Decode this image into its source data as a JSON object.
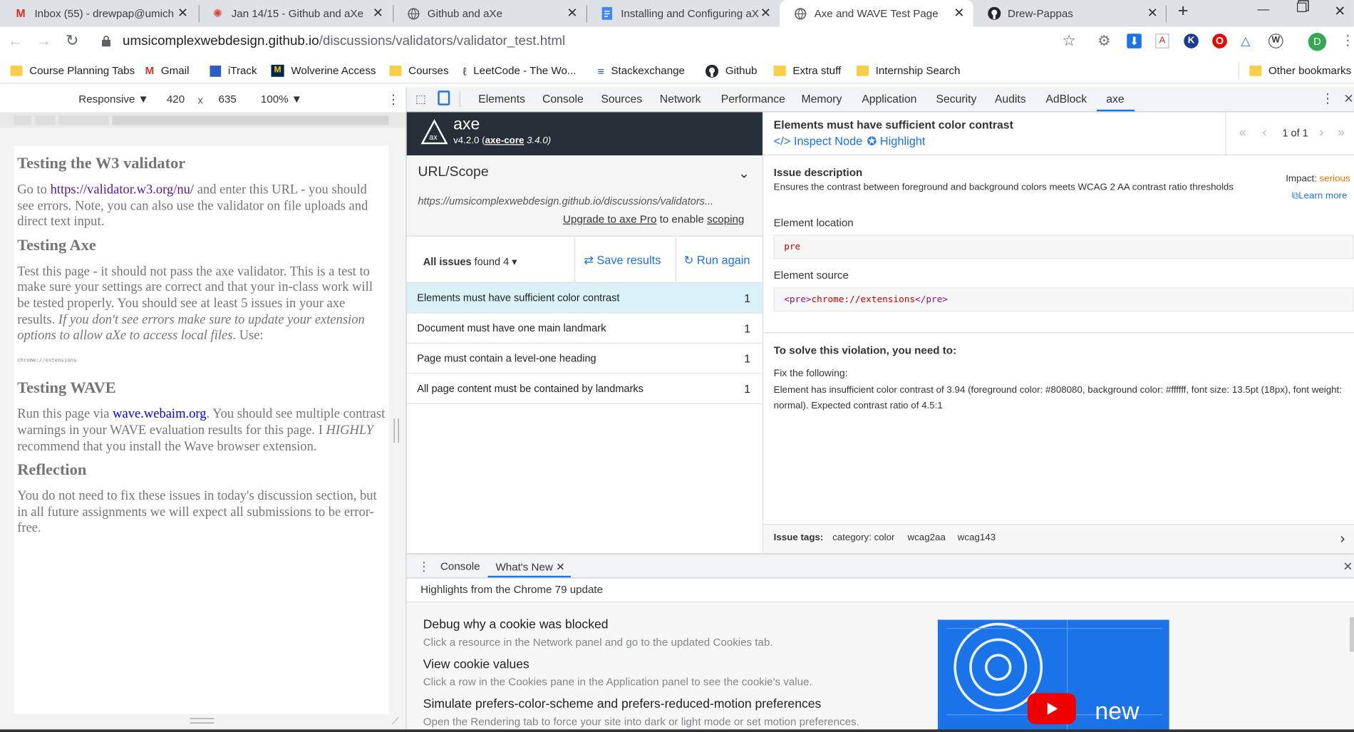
{
  "tabs": [
    {
      "label": "Inbox (55) - drewpap@umich",
      "icon": "gmail-icon"
    },
    {
      "label": "Jan 14/15 - Github and aXe",
      "icon": "canvas-icon"
    },
    {
      "label": "Github and aXe",
      "icon": "globe-icon"
    },
    {
      "label": "Installing and Configuring aX",
      "icon": "docs-icon"
    },
    {
      "label": "Axe and WAVE Test Page",
      "icon": "globe-icon"
    },
    {
      "label": "Drew-Pappas",
      "icon": "github-icon"
    }
  ],
  "address": {
    "host": "umsicomplexwebdesign.github.io",
    "path": "/discussions/validators/validator_test.html"
  },
  "profile_initial": "D",
  "bookmarks": [
    "Course Planning Tabs",
    "Gmail",
    "iTrack",
    "Wolverine Access",
    "Courses",
    "LeetCode - The Wo...",
    "Stackexchange",
    "Github",
    "Extra stuff",
    "Internship Search"
  ],
  "other_bookmarks": "Other bookmarks",
  "device_toolbar": {
    "mode": "Responsive ▼",
    "width": "420",
    "times": "x",
    "height": "635",
    "zoom": "100% ▼"
  },
  "devtools_tabs": [
    "Elements",
    "Console",
    "Sources",
    "Network",
    "Performance",
    "Memory",
    "Application",
    "Security",
    "Audits",
    "AdBlock",
    "axe"
  ],
  "page": {
    "h1": "Testing the W3 validator",
    "p1_pre": "Go to ",
    "p1_link": "https://validator.w3.org/nu/",
    "p1_post": " and enter this URL - you should see errors. Note, you can also use the validator on file uploads and direct text input.",
    "h2": "Testing Axe",
    "p2": "Test this page - it should not pass the axe validator. This is a test to make sure your settings are correct and that your in-class work will be tested properly. You should see at least 5 issues in your axe results. ",
    "p2_em": "If you don't see errors make sure to update your extension options to allow aXe to access local files",
    "p2_post": ". Use:",
    "pre": "chrome://extensions",
    "h3": "Testing WAVE",
    "p3_pre": "Run this page via ",
    "p3_link": "wave.webaim.org",
    "p3_post": ". You should see multiple contrast warnings in your WAVE evaluation results for this page. I ",
    "p3_em": "HIGHLY",
    "p3_post2": " recommend that you install the Wave browser extension.",
    "h4": "Reflection",
    "p4": "You do not need to fix these issues in today's discussion section, but in all future assignments we will expect all submissions to be error-free."
  },
  "axe": {
    "name": "axe",
    "version": "v4.2.0 (",
    "core": "axe-core",
    "core_version": " 3.4.0)",
    "scope_label": "URL/Scope",
    "scope_url": "https://umsicomplexwebdesign.github.io/discussions/validators...",
    "upgrade_link": "Upgrade to axe Pro",
    "upgrade_mid": " to enable ",
    "upgrade_scoping": "scoping",
    "issues_label": "All issues",
    "found_label": " found 4 ▾",
    "save_label": "Save results",
    "run_label": "Run again",
    "issues": [
      {
        "title": "Elements must have sufficient color contrast",
        "count": "1"
      },
      {
        "title": "Document must have one main landmark",
        "count": "1"
      },
      {
        "title": "Page must contain a level-one heading",
        "count": "1"
      },
      {
        "title": "All page content must be contained by landmarks",
        "count": "1"
      }
    ],
    "detail": {
      "title": "Elements must have sufficient color contrast",
      "inspect": "Inspect Node",
      "highlight": "Highlight",
      "pager": "1 of 1",
      "desc_label": "Issue description",
      "desc": "Ensures the contrast between foreground and background colors meets WCAG 2 AA contrast ratio thresholds",
      "impact_label": "Impact: ",
      "impact": "serious",
      "learn_more": "Learn more",
      "location_label": "Element location",
      "location": "pre",
      "source_label": "Element source",
      "source_open": "<pre>",
      "source_text": "chrome://extensions",
      "source_close": "</pre>",
      "solve_title": "To solve this violation, you need to:",
      "fix_label": "Fix the following:",
      "fix_text": "Element has insufficient color contrast of 3.94 (foreground color: #808080, background color: #ffffff, font size: 13.5pt (18px), font weight: normal). Expected contrast ratio of 4.5:1",
      "tags_label": "Issue tags:",
      "tags": [
        "category: color",
        "wcag2aa",
        "wcag143"
      ]
    }
  },
  "drawer": {
    "tabs": [
      "Console",
      "What's New"
    ],
    "header": "Highlights from the Chrome 79 update",
    "items": [
      {
        "title": "Debug why a cookie was blocked",
        "sub": "Click a resource in the Network panel and go to the updated Cookies tab."
      },
      {
        "title": "View cookie values",
        "sub": "Click a row in the Cookies pane in the Application panel to see the cookie's value."
      },
      {
        "title": "Simulate prefers-color-scheme and prefers-reduced-motion preferences",
        "sub": "Open the Rendering tab to force your site into dark or light mode or set motion preferences."
      }
    ],
    "video_word": "new"
  },
  "colors": {
    "accent": "#1a73e8",
    "axe_dark": "#262f38",
    "selected_issue": "#d9f1f7",
    "impact": "#e37400"
  }
}
